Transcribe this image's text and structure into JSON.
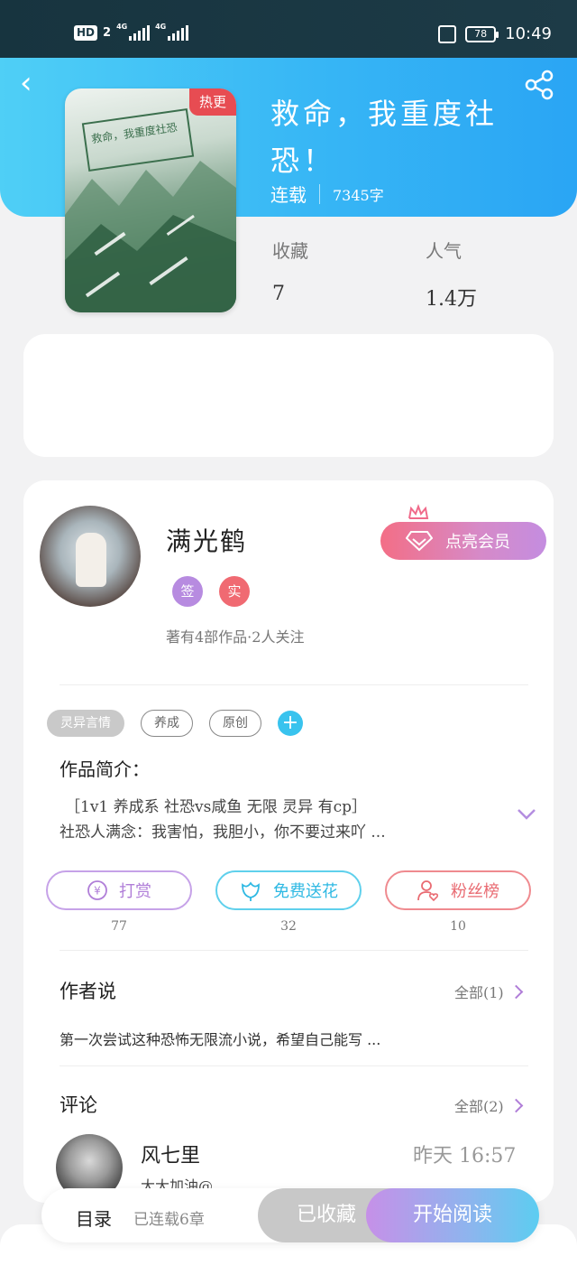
{
  "status_bar": {
    "hd": "HD",
    "hd_num": "2",
    "net1": "4G",
    "net2": "4G",
    "battery": "78",
    "time": "10:49"
  },
  "header": {
    "back_icon": "back-arrow-icon",
    "share_icon": "share-icon",
    "accent": "#37b6f5"
  },
  "book": {
    "cover_title": "救命，我重度社恐",
    "hot_label": "热更",
    "title": "救命，我重度社恐！",
    "status": "连载",
    "word_count": "7345字",
    "favorites_label": "收藏",
    "favorites_value": "7",
    "popularity_label": "人气",
    "popularity_value": "1.4万"
  },
  "author": {
    "name": "满光鹤",
    "badge_sign": "签",
    "badge_real": "实",
    "stats": "著有4部作品·2人关注",
    "vip_label": "点亮会员"
  },
  "tags": [
    "灵异言情",
    "养成",
    "原创"
  ],
  "intro": {
    "heading": "作品简介：",
    "line1": "［1v1 养成系 社恐vs咸鱼 无限 灵异 有cp］",
    "line2": "社恐人满念：我害怕，我胆小，你不要过来吖 ..."
  },
  "actions": {
    "tip_label": "打赏",
    "tip_count": "77",
    "flower_label": "免费送花",
    "flower_count": "32",
    "fans_label": "粉丝榜",
    "fans_count": "10"
  },
  "author_say": {
    "heading": "作者说",
    "more": "全部(1)",
    "text": "第一次尝试这种恐怖无限流小说，希望自己能写 ..."
  },
  "comments": {
    "heading": "评论",
    "more": "全部(2)",
    "name": "风七里",
    "time": "昨天 16:57",
    "text": "大大加油@..."
  },
  "bottom": {
    "toc": "目录",
    "toc_sub": "已连载6章",
    "fav_button": "已收藏",
    "read_button": "开始阅读"
  }
}
